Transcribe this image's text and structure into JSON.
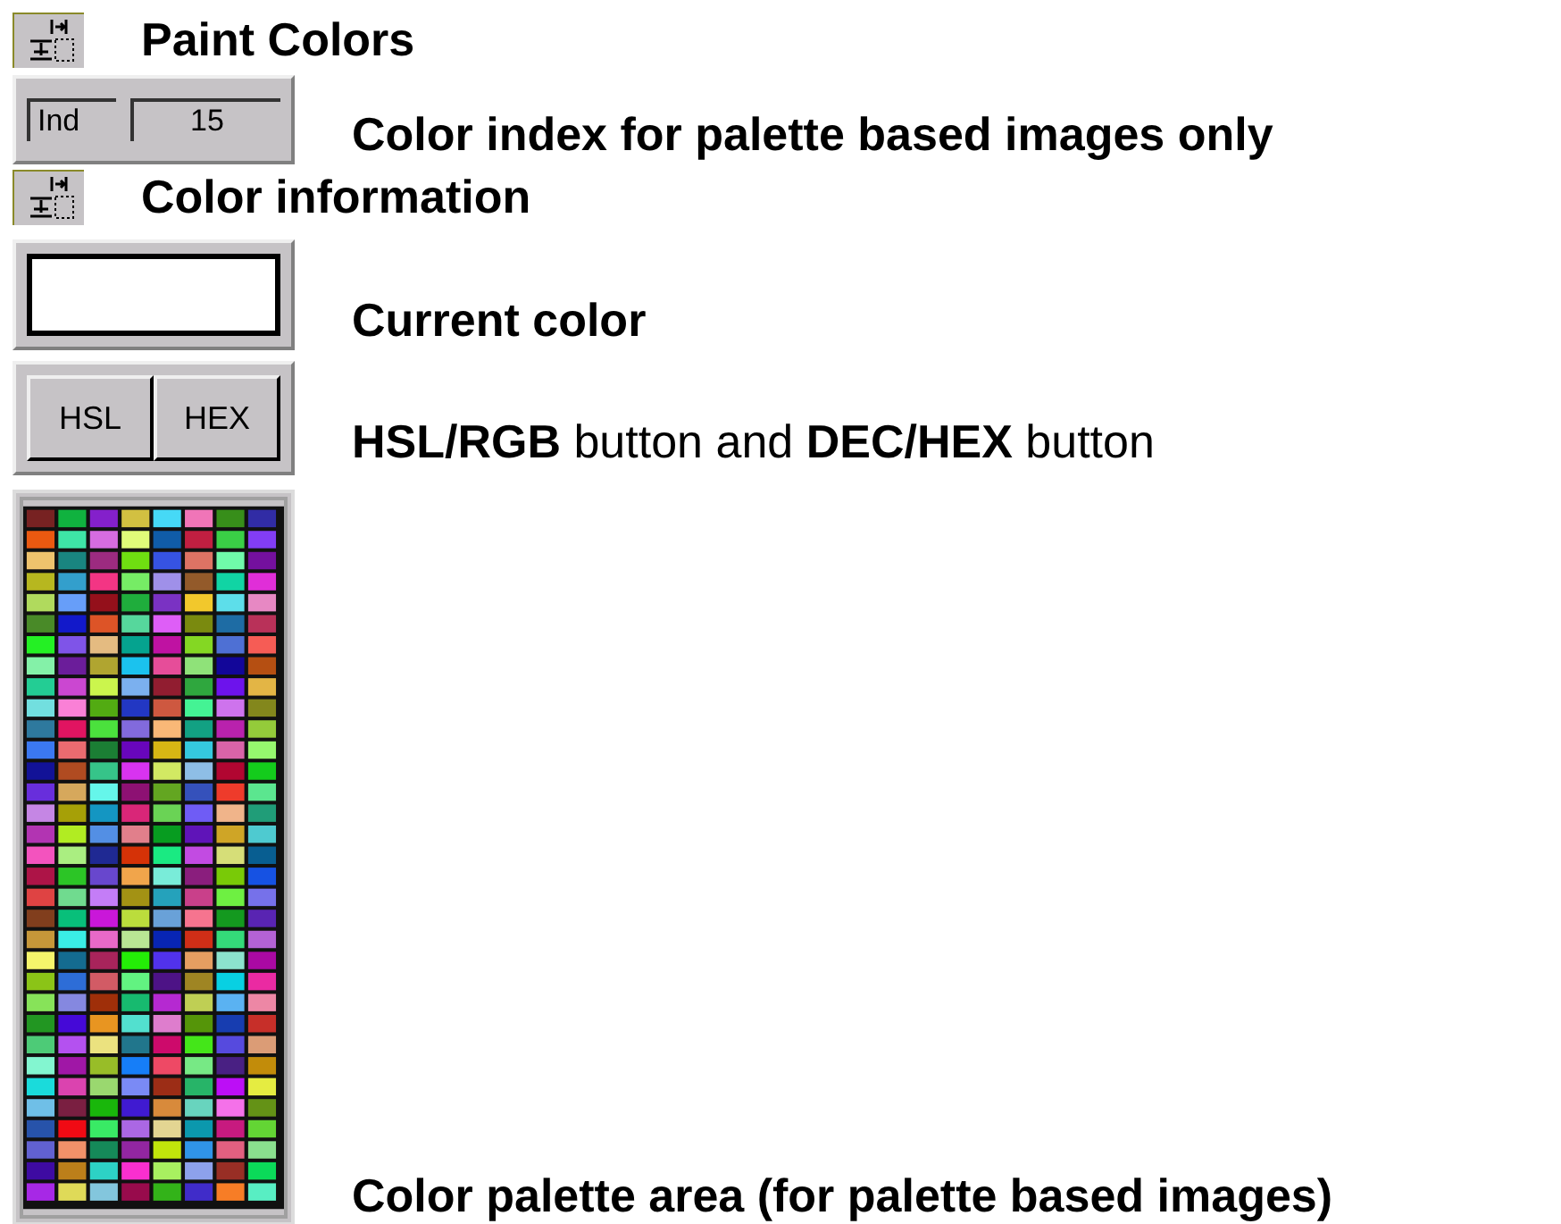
{
  "sections": [
    {
      "kind": "heading",
      "text": "Paint Colors"
    },
    {
      "kind": "index",
      "fields": [
        "Ind",
        "15"
      ],
      "text": "Color index for palette based images only"
    },
    {
      "kind": "heading",
      "text": "Color information"
    },
    {
      "kind": "current",
      "text": "Current color"
    },
    {
      "kind": "buttons",
      "buttons": [
        "HSL",
        "HEX"
      ],
      "text": "**HSL/RGB** button and **DEC/HEX** button"
    },
    {
      "kind": "palette",
      "text": "Color palette area (for palette based images)"
    }
  ]
}
